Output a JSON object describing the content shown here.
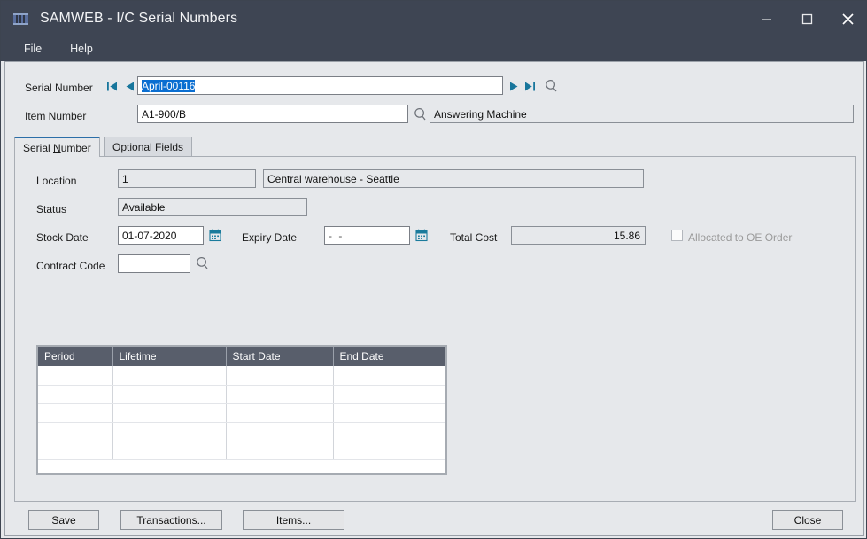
{
  "window": {
    "title": "SAMWEB - I/C Serial Numbers",
    "app_icon": "barcode-icon",
    "controls": {
      "minimize": "minimize-icon",
      "maximize": "maximize-icon",
      "close": "close-icon"
    }
  },
  "menubar": {
    "items": [
      {
        "label": "File"
      },
      {
        "label": "Help"
      }
    ]
  },
  "header": {
    "serial_number": {
      "label": "Serial Number",
      "value": "April-00116",
      "selected": true,
      "nav": {
        "first": "first-record-icon",
        "previous": "previous-record-icon",
        "next": "next-record-icon",
        "last": "last-record-icon",
        "finder": "finder-magnifier-icon"
      }
    },
    "item_number": {
      "label": "Item Number",
      "value": "A1-900/B",
      "finder": "finder-magnifier-icon",
      "description": "Answering Machine"
    }
  },
  "tabs": [
    {
      "id": "serial-number",
      "pre": "Serial ",
      "accel": "N",
      "post": "umber",
      "active": true
    },
    {
      "id": "optional-fields",
      "pre": "",
      "accel": "O",
      "post": "ptional Fields",
      "active": false
    }
  ],
  "form": {
    "location": {
      "label": "Location",
      "code": "1",
      "description": "Central warehouse - Seattle"
    },
    "status": {
      "label": "Status",
      "value": "Available"
    },
    "stock_date": {
      "label": "Stock Date",
      "value": "01-07-2020",
      "calendar_icon": "calendar-icon"
    },
    "expiry_date": {
      "label": "Expiry Date",
      "value": "-  -",
      "calendar_icon": "calendar-icon"
    },
    "total_cost": {
      "label": "Total Cost",
      "value": "15.86"
    },
    "allocated": {
      "label": "Allocated to OE Order",
      "checked": false,
      "disabled": true
    },
    "contract_code": {
      "label": "Contract Code",
      "value": "",
      "finder": "finder-magnifier-icon"
    }
  },
  "grid": {
    "columns": [
      "Period",
      "Lifetime",
      "Start Date",
      "End Date"
    ],
    "rows": [
      [
        "",
        "",
        "",
        ""
      ],
      [
        "",
        "",
        "",
        ""
      ],
      [
        "",
        "",
        "",
        ""
      ],
      [
        "",
        "",
        "",
        ""
      ],
      [
        "",
        "",
        "",
        ""
      ]
    ]
  },
  "footer": {
    "save": "Save",
    "transactions": "Transactions...",
    "items": "Items...",
    "close": "Close"
  },
  "colors": {
    "titlebar": "#3e4553",
    "accent_teal": "#18769c",
    "selection_blue": "#0a6ed1",
    "grid_header": "#585e6b",
    "client_bg": "#e6e8eb",
    "tab_active_top": "#2b6ea8"
  }
}
